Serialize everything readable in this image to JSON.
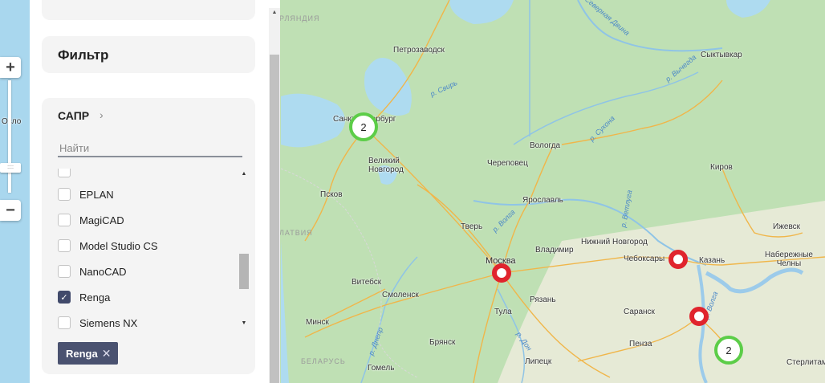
{
  "panel": {
    "filter_title": "Фильтр",
    "sapr": {
      "title": "САПР",
      "chevron": "›",
      "search_placeholder": "Найти",
      "items": [
        {
          "label": "EPLAN",
          "checked": false
        },
        {
          "label": "MagiCAD",
          "checked": false
        },
        {
          "label": "Model Studio CS",
          "checked": false
        },
        {
          "label": "NanoCAD",
          "checked": false
        },
        {
          "label": "Renga",
          "checked": true
        },
        {
          "label": "Siemens NX",
          "checked": false
        }
      ],
      "check_mark": "✓",
      "scroll_up": "▲",
      "scroll_down": "▼"
    },
    "selected_tag": {
      "label": "Renga",
      "remove": "✕"
    }
  },
  "map": {
    "zoom_in": "+",
    "zoom_out": "−",
    "zoom_handle": "::::",
    "cities": [
      "Осло",
      "Петрозаводск",
      "Санкт-Петербург",
      "Великий Новгород",
      "Псков",
      "Вологда",
      "Череповец",
      "Ярославль",
      "Тверь",
      "Москва",
      "Владимир",
      "Нижний Новгород",
      "Чебоксары",
      "Казань",
      "Киров",
      "Сыктывкар",
      "Ижевск",
      "Набережные Челны",
      "Витебск",
      "Смоленск",
      "Минск",
      "Тула",
      "Рязань",
      "Саранск",
      "Пенза",
      "Брянск",
      "Липецк",
      "Гомель",
      "Стерлитамак"
    ],
    "rivers": [
      "Северная Двина",
      "р. Вычегда",
      "р. Свирь",
      "р. Сухона",
      "р. Волга",
      "р. Ветлуга",
      "р. Днепр",
      "р. Дон",
      "р. Волга"
    ],
    "countries": [
      "РЛЯНДИЯ",
      "ЛАТВИЯ",
      "БЕЛАРУСЬ"
    ],
    "clusters": [
      "2",
      "2"
    ],
    "colors": {
      "cluster_ring": "#5ccd48",
      "marker": "#e0242d",
      "land": "#bfe0b4",
      "water": "#aedbf0",
      "accent": "#4a5270"
    }
  }
}
